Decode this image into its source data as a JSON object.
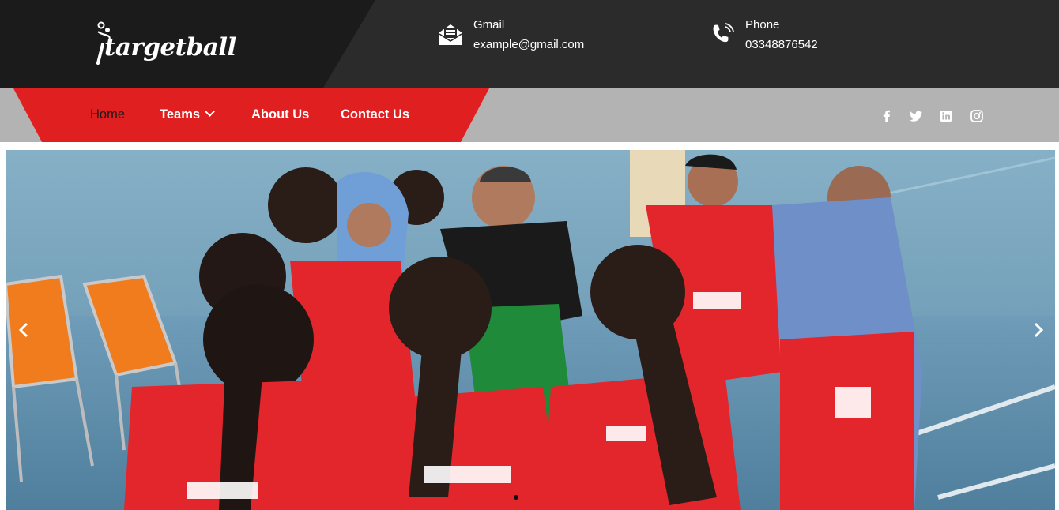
{
  "brand": {
    "logo_text": "targetball"
  },
  "contacts": {
    "gmail": {
      "label": "Gmail",
      "value": "example@gmail.com",
      "icon": "mail-icon"
    },
    "phone": {
      "label": "Phone",
      "value": "03348876542",
      "icon": "phone-icon"
    }
  },
  "nav": {
    "items": [
      {
        "label": "Home",
        "active": true
      },
      {
        "label": "Teams",
        "dropdown": true
      },
      {
        "label": "About Us"
      },
      {
        "label": "Contact Us"
      }
    ]
  },
  "social": [
    "facebook-icon",
    "twitter-icon",
    "linkedin-icon",
    "instagram-icon"
  ],
  "slider": {
    "current": 1,
    "total": 1,
    "prev_icon": "chevron-left-icon",
    "next_icon": "chevron-right-icon"
  },
  "colors": {
    "topbar": "#2b2b2b",
    "logo_bg": "#1b1b1b",
    "nav_red": "#e02020",
    "nav_gray": "#b3b3b3"
  }
}
